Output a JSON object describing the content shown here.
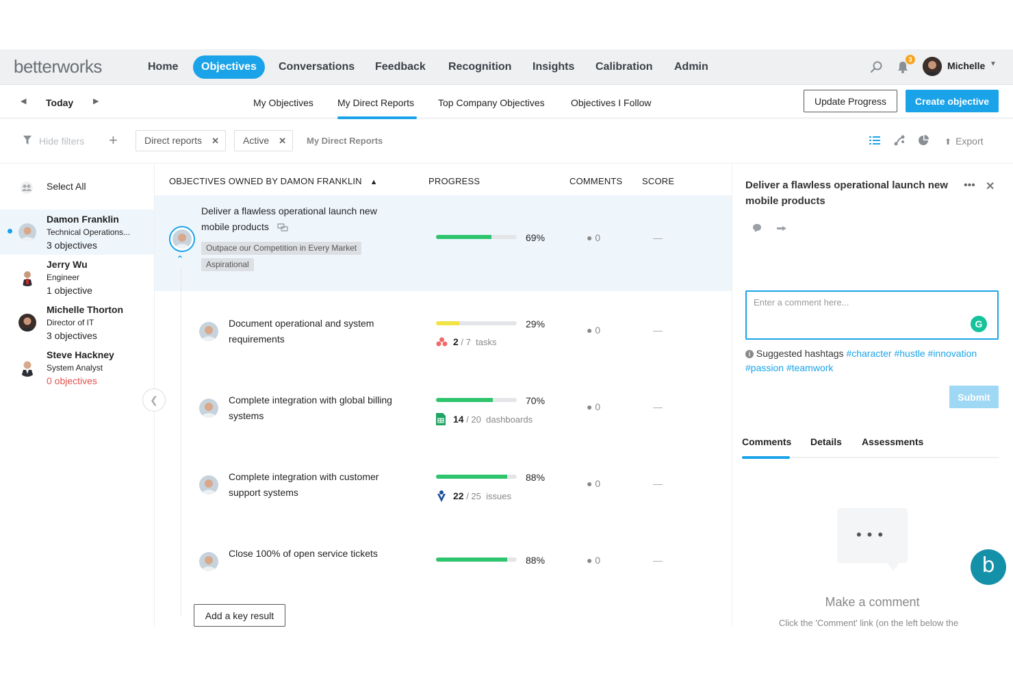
{
  "brand": {
    "logo_text": "betterworks",
    "accent": "#1aa3e8",
    "progress_green": "#2ec46d"
  },
  "nav": {
    "items": [
      "Home",
      "Objectives",
      "Conversations",
      "Feedback",
      "Recognition",
      "Insights",
      "Calibration",
      "Admin"
    ],
    "active": "Objectives",
    "notification_count": "3",
    "user_name": "Michelle",
    "icons": [
      "search-icon",
      "bell-icon",
      "avatar",
      "chevron-down-icon"
    ]
  },
  "subnav": {
    "date_label": "Today",
    "tabs": [
      "My Objectives",
      "My Direct Reports",
      "Top Company Objectives",
      "Objectives I Follow"
    ],
    "active_tab": "My Direct Reports",
    "update_progress_label": "Update Progress",
    "create_objective_label": "Create objective"
  },
  "filters": {
    "hide_filters_label": "Hide filters",
    "chips": [
      "Direct reports",
      "Active"
    ],
    "context_label": "My Direct Reports",
    "export_label": "Export"
  },
  "people": {
    "select_all_label": "Select All",
    "list": [
      {
        "name": "Damon Franklin",
        "role": "Technical Operations...",
        "count": "3 objectives",
        "active": true
      },
      {
        "name": "Jerry Wu",
        "role": "Engineer",
        "count": "1 objective"
      },
      {
        "name": "Michelle Thorton",
        "role": "Director of IT",
        "count": "3 objectives"
      },
      {
        "name": "Steve Hackney",
        "role": "System Analyst",
        "count": "0 objectives"
      }
    ]
  },
  "table": {
    "headers": {
      "objectives": "OBJECTIVES OWNED BY DAMON FRANKLIN",
      "progress": "PROGRESS",
      "comments": "COMMENTS",
      "score": "SCORE"
    },
    "objective": {
      "title": "Deliver a flawless operational launch new mobile products",
      "tags": [
        "Outpace our Competition in Every Market",
        "Aspirational"
      ],
      "progress_pct": 69,
      "progress_label": "69%",
      "comments": "0",
      "score": "—"
    },
    "key_results": [
      {
        "title": "Document operational and system requirements",
        "progress_pct": 29,
        "progress_label": "29%",
        "bar_color": "yellow",
        "stat_done": "2",
        "stat_total": "/ 7",
        "stat_unit": "tasks",
        "stat_icon": "asana-icon",
        "comments": "0",
        "score": "—"
      },
      {
        "title": "Complete integration with global billing systems",
        "progress_pct": 70,
        "progress_label": "70%",
        "bar_color": "green",
        "stat_done": "14",
        "stat_total": "/ 20",
        "stat_unit": "dashboards",
        "stat_icon": "sheets-icon",
        "comments": "0",
        "score": "—"
      },
      {
        "title": "Complete integration with customer support systems",
        "progress_pct": 88,
        "progress_label": "88%",
        "bar_color": "green",
        "stat_done": "22",
        "stat_total": "/ 25",
        "stat_unit": "issues",
        "stat_icon": "jira-icon",
        "comments": "0",
        "score": "—"
      },
      {
        "title": "Close 100% of open service tickets",
        "progress_pct": 88,
        "progress_label": "88%",
        "bar_color": "green",
        "comments": "0",
        "score": "—"
      }
    ],
    "add_key_result_label": "Add a key result"
  },
  "panel": {
    "title": "Deliver a flawless operational launch new mobile products",
    "comment_placeholder": "Enter a comment here...",
    "hashtags_label": "Suggested hashtags",
    "hashtags": [
      "#character",
      "#hustle",
      "#innovation",
      "#passion",
      "#teamwork"
    ],
    "submit_label": "Submit",
    "tabs": [
      "Comments",
      "Details",
      "Assessments"
    ],
    "active_tab": "Comments",
    "empty_title": "Make a comment",
    "empty_sub": "Click the 'Comment' link (on the left below the"
  }
}
